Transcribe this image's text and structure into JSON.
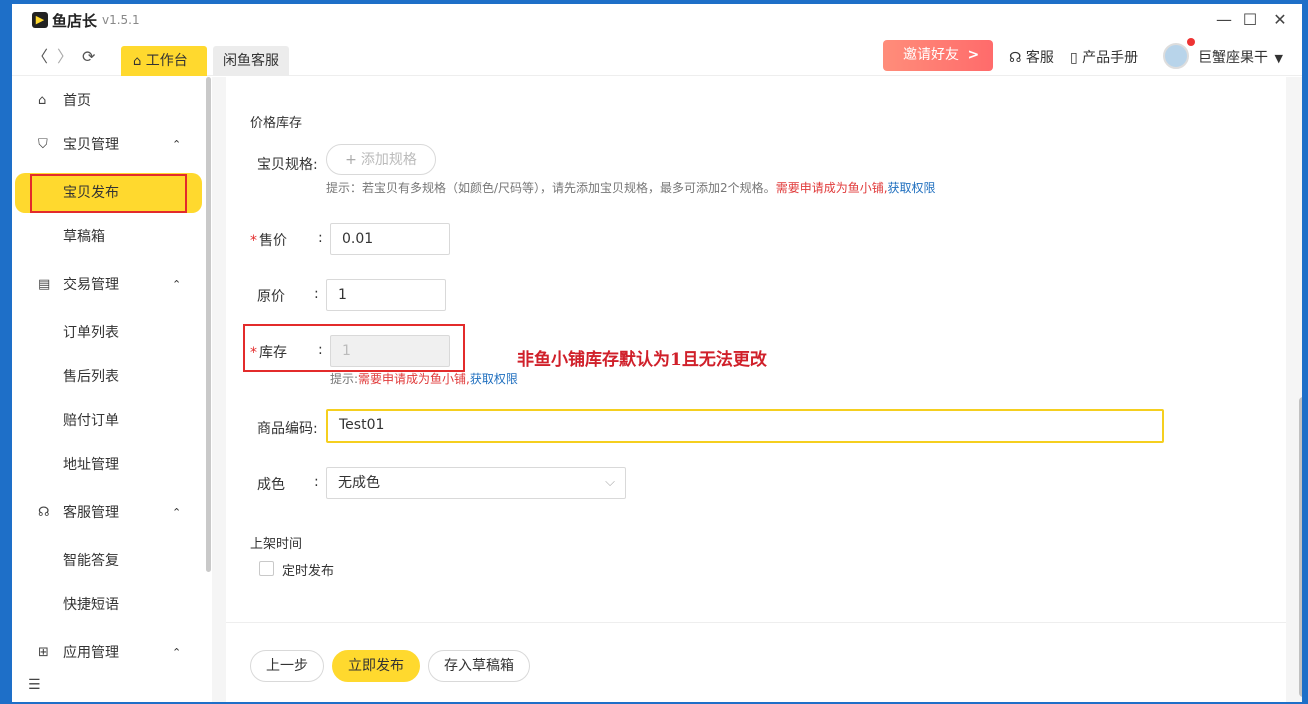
{
  "app": {
    "name": "鱼店长",
    "version": "v1.5.1"
  },
  "window_controls": {
    "minimize": "—",
    "maximize": "☐",
    "close": "✕"
  },
  "nav": {
    "back": "〈",
    "forward": "〉",
    "refresh": "⟳",
    "tabs": [
      {
        "label": "工作台",
        "icon": "home-icon"
      },
      {
        "label": "闲鱼客服"
      }
    ]
  },
  "topbar": {
    "invite": "邀请好友",
    "invite_arrow": ">",
    "service": "客服",
    "manual": "产品手册",
    "user": "巨蟹座果干",
    "user_caret": "▼"
  },
  "sidebar": {
    "items": [
      {
        "label": "首页",
        "icon": "home-icon",
        "glyph": "⌂"
      },
      {
        "label": "宝贝管理",
        "icon": "bag-icon",
        "glyph": "⛉",
        "caret": "⌃"
      },
      {
        "label": "宝贝发布"
      },
      {
        "label": "草稿箱"
      },
      {
        "label": "交易管理",
        "icon": "document-icon",
        "glyph": "▤",
        "caret": "⌃"
      },
      {
        "label": "订单列表"
      },
      {
        "label": "售后列表"
      },
      {
        "label": "赔付订单"
      },
      {
        "label": "地址管理"
      },
      {
        "label": "客服管理",
        "icon": "headset-icon",
        "glyph": "☊",
        "caret": "⌃"
      },
      {
        "label": "智能答复"
      },
      {
        "label": "快捷短语"
      },
      {
        "label": "应用管理",
        "icon": "apps-icon",
        "glyph": "⊞",
        "caret": "⌃"
      }
    ],
    "collapse_glyph": "☰"
  },
  "form": {
    "section_price": "价格库存",
    "spec_label": "宝贝规格:",
    "spec_button": "添加规格",
    "spec_plus": "+",
    "spec_hint": {
      "text": "提示：若宝贝有多规格（如颜色/尺码等），请先添加宝贝规格，最多可添加2个规格。",
      "red": "需要申请成为鱼小铺,",
      "link": "获取权限"
    },
    "price": {
      "label": "售价",
      "required": "*",
      "colon": ":",
      "value": "0.01"
    },
    "original_price": {
      "label": "原价",
      "colon": ":",
      "value": "1"
    },
    "stock": {
      "label": "库存",
      "required": "*",
      "colon": ":",
      "value": "1",
      "hint_prefix": "提示:",
      "hint_red": "需要申请成为鱼小铺,",
      "hint_link": "获取权限"
    },
    "annotation": "非鱼小铺库存默认为1且无法更改",
    "code": {
      "label": "商品编码:",
      "value": "Test01"
    },
    "condition": {
      "label": "成色",
      "colon": ":",
      "value": "无成色",
      "caret": "⌵"
    },
    "section_time": "上架时间",
    "schedule_label": "定时发布"
  },
  "footer": {
    "prev": "上一步",
    "publish": "立即发布",
    "draft": "存入草稿箱"
  },
  "colors": {
    "accent": "#ffd92e",
    "danger": "#e32b2b",
    "link": "#1f6fbf",
    "invite": "#ff7a6e"
  }
}
